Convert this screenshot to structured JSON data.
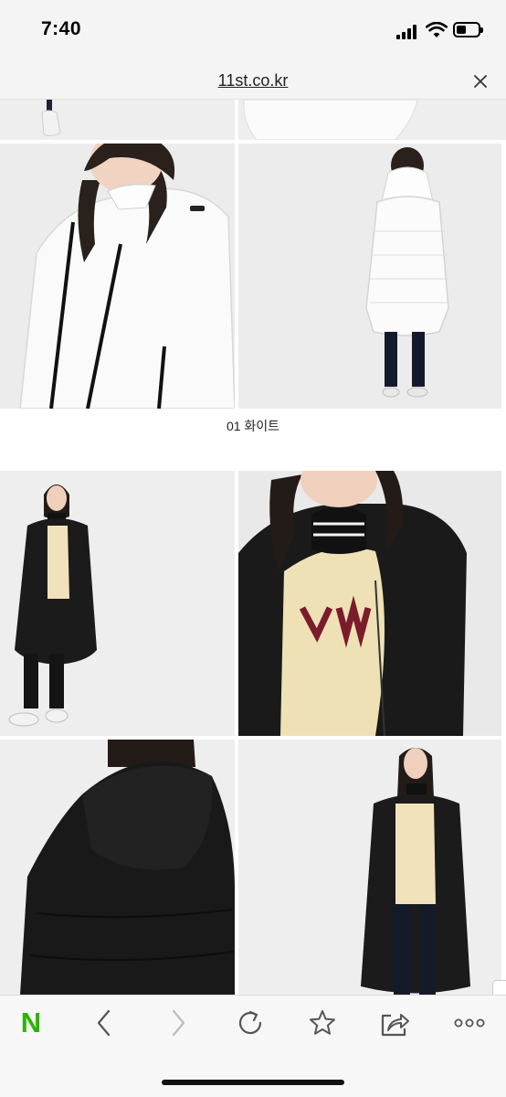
{
  "status_bar": {
    "time": "7:40"
  },
  "url_bar": {
    "url": "11st.co.kr"
  },
  "content": {
    "caption": "01 화이트",
    "photos": [
      "white-coat-legs-top-left",
      "white-coat-hem-top-right",
      "white-coat-front-closeup",
      "white-coat-back-full",
      "black-coat-front-full",
      "black-coat-front-closeup",
      "black-coat-back-hood",
      "black-coat-front-full-2"
    ]
  },
  "toolbar": {
    "logo_letter": "N",
    "buttons": [
      "naver-n-icon",
      "back-chevron-icon",
      "forward-chevron-icon",
      "reload-icon",
      "star-icon",
      "share-icon",
      "more-icon"
    ]
  },
  "colors": {
    "naver_green": "#2db400",
    "photo_background": "#eeeeee",
    "coat_black": "#1b1b1b"
  }
}
